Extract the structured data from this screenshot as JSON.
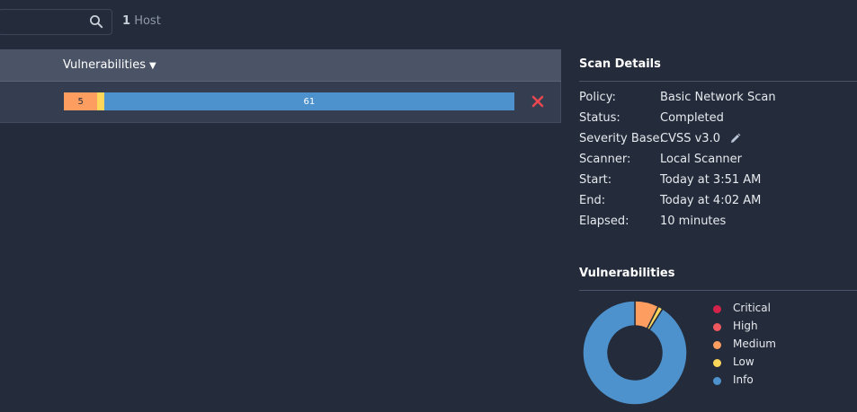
{
  "search": {
    "placeholder": ""
  },
  "hosts": {
    "count": "1",
    "label": "Host"
  },
  "table": {
    "column_vulnerabilities": "Vulnerabilities",
    "row": {
      "counts": {
        "critical": 0,
        "high": 0,
        "medium": 5,
        "low": 1,
        "info": 61
      },
      "medium_label": "5",
      "info_label": "61"
    }
  },
  "scan_details": {
    "title": "Scan Details",
    "rows": [
      {
        "label": "Policy:",
        "value": "Basic Network Scan"
      },
      {
        "label": "Status:",
        "value": "Completed"
      },
      {
        "label": "Severity Base:",
        "value": "CVSS v3.0"
      },
      {
        "label": "Scanner:",
        "value": "Local Scanner"
      },
      {
        "label": "Start:",
        "value": "Today at 3:51 AM"
      },
      {
        "label": "End:",
        "value": "Today at 4:02 AM"
      },
      {
        "label": "Elapsed:",
        "value": "10 minutes"
      }
    ]
  },
  "vulnerabilities": {
    "title": "Vulnerabilities",
    "legend": [
      {
        "label": "Critical",
        "color": "#d4234a"
      },
      {
        "label": "High",
        "color": "#ee5960"
      },
      {
        "label": "Medium",
        "color": "#fd9d5f"
      },
      {
        "label": "Low",
        "color": "#fdd65a"
      },
      {
        "label": "Info",
        "color": "#4e92cd"
      }
    ]
  },
  "chart_data": {
    "type": "pie",
    "categories": [
      "Critical",
      "High",
      "Medium",
      "Low",
      "Info"
    ],
    "values": [
      0,
      0,
      5,
      1,
      61
    ],
    "title": "Vulnerabilities"
  }
}
